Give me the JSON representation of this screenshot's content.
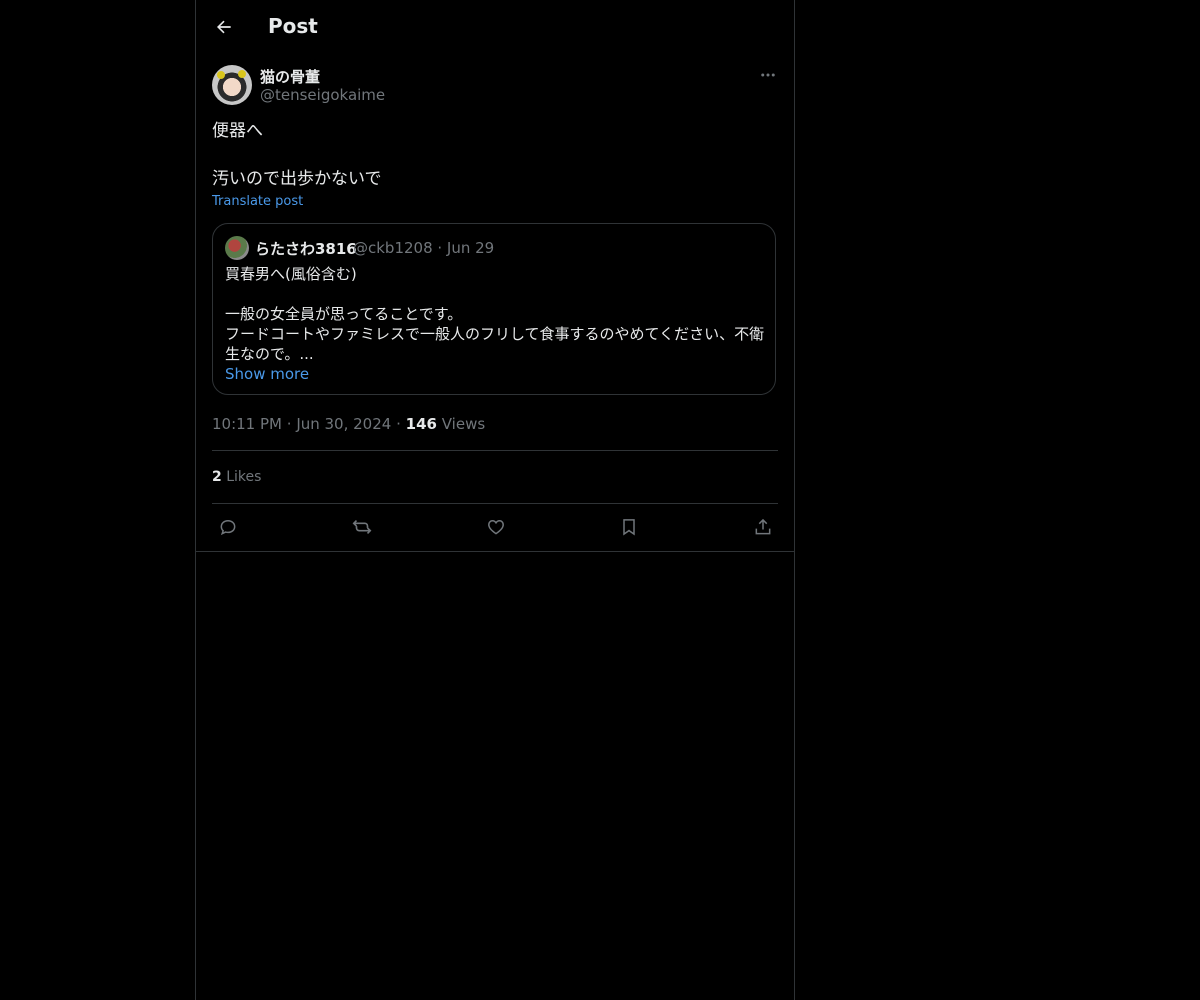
{
  "header": {
    "title": "Post"
  },
  "post": {
    "author": {
      "display_name": "猫の骨董",
      "handle": "@tenseigokaime"
    },
    "text": "便器へ\n\n汚いので出歩かないで",
    "translate_label": "Translate post",
    "quote": {
      "display_name": "らたさわ3816",
      "meta": "@ckb1208 · Jun 29",
      "text": "買春男へ(風俗含む)\n\n一般の女全員が思ってることです。\nフードコートやファミレスで一般人のフリして食事するのやめてください、不衛生なので。...",
      "show_more": "Show more"
    },
    "time": "10:11 PM",
    "date": "Jun 30, 2024",
    "views_count": "146",
    "views_label": "Views",
    "likes_count": "2",
    "likes_label": "Likes"
  },
  "icons": {
    "back": "arrow-left-icon",
    "more": "more-horizontal-icon",
    "reply": "reply-icon",
    "repost": "repost-icon",
    "like": "heart-icon",
    "bookmark": "bookmark-icon",
    "share": "share-icon"
  },
  "colors": {
    "background": "#000000",
    "text": "#e7e9ea",
    "muted": "#71767b",
    "link": "#4a99e9",
    "border": "#2f3336"
  }
}
